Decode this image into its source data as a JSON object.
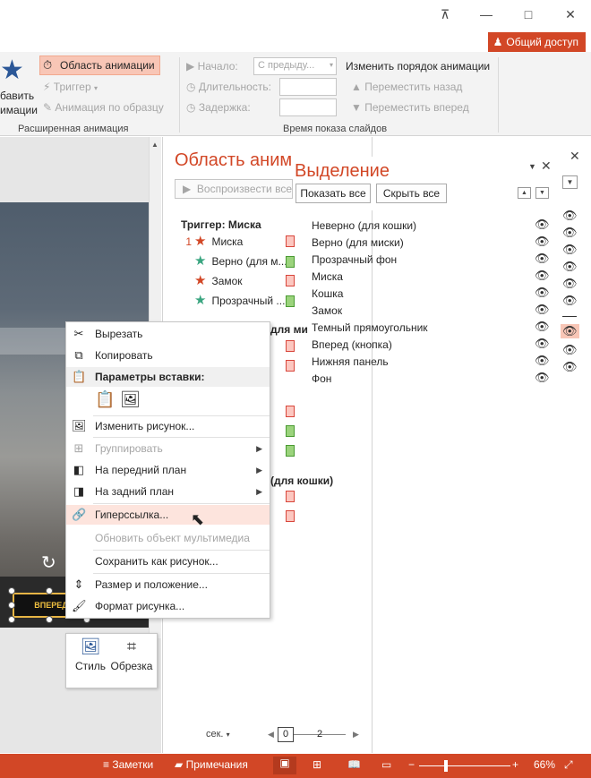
{
  "window": {
    "minimize": "—",
    "restore": "□",
    "close": "✕",
    "ribbon_toggle": "⊼"
  },
  "share": {
    "label": "Общий доступ"
  },
  "ribbon": {
    "add_anim_line1": "бавить",
    "add_anim_line2": "имации",
    "anim_pane_btn": "Область анимации",
    "trigger_btn": "Триггер",
    "painter_btn": "Анимация по образцу",
    "group_adv": "Расширенная анимация",
    "start_label": "Начало:",
    "start_value": "С предыду...",
    "duration_label": "Длительность:",
    "delay_label": "Задержка:",
    "reorder_label": "Изменить порядок анимации",
    "move_back": "Переместить назад",
    "move_forward": "Переместить вперед",
    "group_timing": "Время показа слайдов"
  },
  "anim_pane": {
    "title": "Область аним",
    "play_btn": "Воспроизвести все",
    "trigger_header": "Триггер: Миска",
    "items": [
      {
        "num": "1",
        "label": "Миска"
      },
      {
        "num": "",
        "label": "Верно (для м..."
      },
      {
        "num": "",
        "label": "Замок"
      },
      {
        "num": "",
        "label": "Прозрачный ..."
      }
    ],
    "partial_1": "для ми",
    "partial_2": "(для кошки)",
    "sec_label": "сек.",
    "scale_start": "0",
    "scale_mid": "2"
  },
  "sel_pane": {
    "title": "Выделение",
    "show_all": "Показать все",
    "hide_all": "Скрыть все",
    "items": [
      "Неверно (для кошки)",
      "Верно (для миски)",
      "Прозрачный фон",
      "Миска",
      "Кошка",
      "Замок",
      "Темный прямоугольник",
      "Вперед (кнопка)",
      "Нижняя панель",
      "Фон"
    ]
  },
  "slide": {
    "button_text": "ВПЕРЕД"
  },
  "context_menu": {
    "cut": "Вырезать",
    "copy": "Копировать",
    "paste_options": "Параметры вставки:",
    "change_picture": "Изменить рисунок...",
    "group": "Группировать",
    "bring_front": "На передний план",
    "send_back": "На задний план",
    "hyperlink": "Гиперссылка...",
    "update_media": "Обновить объект мультимедиа",
    "save_as_picture": "Сохранить как рисунок...",
    "size_position": "Размер и положение...",
    "format_picture": "Формат рисунка..."
  },
  "minibar": {
    "style": "Стиль",
    "crop": "Обрезка"
  },
  "status": {
    "notes": "Заметки",
    "comments": "Примечания",
    "zoom": "66%"
  },
  "colors": {
    "accent": "#d24726"
  }
}
